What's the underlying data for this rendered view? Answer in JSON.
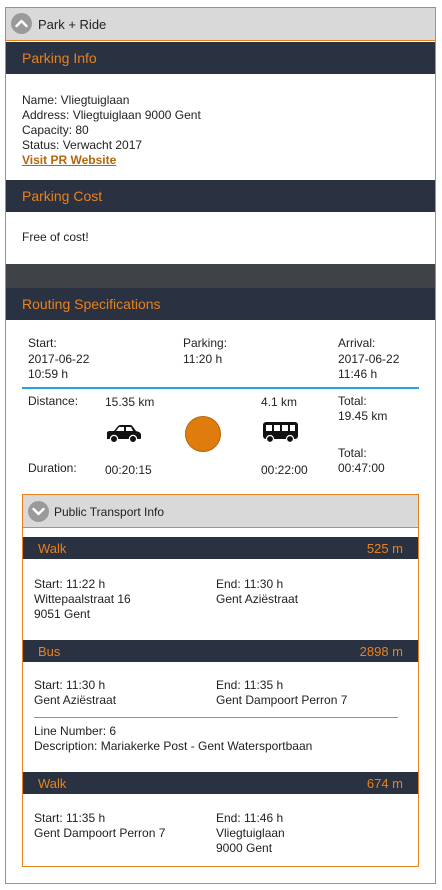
{
  "accordion_title": "Park + Ride",
  "parking_info": {
    "heading": "Parking Info",
    "name": "Name: Vliegtuiglaan",
    "address": "Address: Vliegtuiglaan 9000 Gent",
    "capacity": "Capacity: 80",
    "status": "Status: Verwacht 2017",
    "website_link": "Visit PR Website"
  },
  "parking_cost": {
    "heading": "Parking Cost",
    "text": "Free of cost!"
  },
  "routing": {
    "heading": "Routing Specifications",
    "start_label": "Start:",
    "start_date": "2017-06-22",
    "start_time": "10:59 h",
    "parking_label": "Parking:",
    "parking_time": "11:20 h",
    "arrival_label": "Arrival:",
    "arrival_date": "2017-06-22",
    "arrival_time": "11:46 h",
    "distance_label": "Distance:",
    "car_distance": "15.35 km",
    "bus_distance": "4.1 km",
    "total_distance_label": "Total:",
    "total_distance": "19.45 km",
    "duration_label": "Duration:",
    "car_duration": "00:20:15",
    "bus_duration": "00:22:00",
    "total_duration_label": "Total:",
    "total_duration": "00:47:00",
    "car_icon": "car-icon",
    "bus_icon": "bus-icon",
    "parking_marker_color": "#e07c0e"
  },
  "public_transport": {
    "title": "Public Transport Info",
    "legs": [
      {
        "mode": "Walk",
        "distance": "525  m",
        "start": "Start: 11:22 h",
        "start_place_1": "Wittepaalstraat 16",
        "start_place_2": "9051 Gent",
        "end": "End: 11:30 h",
        "end_place_1": "Gent Aziëstraat",
        "end_place_2": ""
      },
      {
        "mode": "Bus",
        "distance": "2898  m",
        "start": "Start: 11:30 h",
        "start_place_1": "Gent Aziëstraat",
        "end": "End: 11:35 h",
        "end_place_1": "Gent Dampoort Perron 7",
        "line_number": "Line Number: 6",
        "description": "Description: Mariakerke Post - Gent Watersportbaan"
      },
      {
        "mode": "Walk",
        "distance": "674  m",
        "start": "Start: 11:35 h",
        "start_place_1": "Gent Dampoort Perron 7",
        "start_place_2": "",
        "end": "End: 11:46 h",
        "end_place_1": "Vliegtuiglaan",
        "end_place_2": "9000 Gent"
      }
    ]
  },
  "colors": {
    "accent": "#e8821e",
    "band": "#2a3140",
    "header_bg": "#d9d9d9",
    "divider_blue": "#2aa4dc"
  }
}
